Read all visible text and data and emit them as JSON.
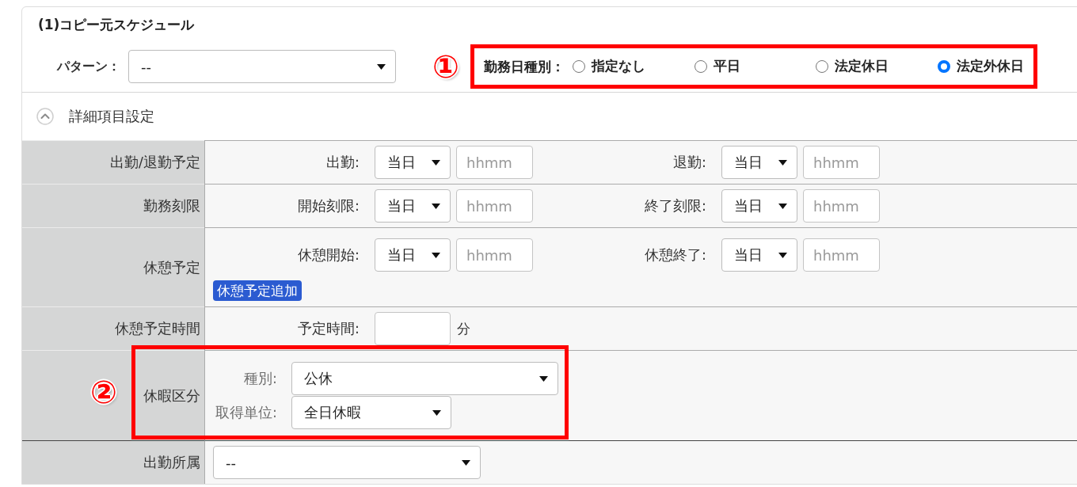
{
  "section": {
    "title": "(1)コピー元スケジュール"
  },
  "pattern": {
    "label": "パターン：",
    "value": "--"
  },
  "workday_type": {
    "annotation": "①",
    "label": "勤務日種別：",
    "options": [
      {
        "label": "指定なし",
        "selected": false
      },
      {
        "label": "平日",
        "selected": false
      },
      {
        "label": "法定休日",
        "selected": false
      },
      {
        "label": "法定外休日",
        "selected": true
      }
    ]
  },
  "details": {
    "label": "詳細項目設定",
    "expanded": true,
    "rows": [
      {
        "kind": "time_pairs",
        "label": "出勤/退勤予定",
        "fields": [
          {
            "label": "出勤:",
            "day": "当日",
            "placeholder": "hhmm"
          },
          {
            "label": "退勤:",
            "day": "当日",
            "placeholder": "hhmm"
          }
        ]
      },
      {
        "kind": "time_pairs",
        "label": "勤務刻限",
        "fields": [
          {
            "label": "開始刻限:",
            "day": "当日",
            "placeholder": "hhmm"
          },
          {
            "label": "終了刻限:",
            "day": "当日",
            "placeholder": "hhmm"
          }
        ]
      },
      {
        "kind": "time_pairs",
        "label": "休憩予定",
        "fields": [
          {
            "label": "休憩開始:",
            "day": "当日",
            "placeholder": "hhmm"
          },
          {
            "label": "休憩終了:",
            "day": "当日",
            "placeholder": "hhmm"
          }
        ],
        "button": "休憩予定追加"
      },
      {
        "kind": "duration",
        "label": "休憩予定時間",
        "field": {
          "label": "予定時間:",
          "unit": "分"
        }
      },
      {
        "kind": "selects",
        "label": "休暇区分",
        "annotation": "②",
        "fields": [
          {
            "label": "種別:",
            "value": "公休"
          },
          {
            "label": "取得単位:",
            "value": "全日休暇"
          }
        ]
      },
      {
        "kind": "select",
        "label": "出勤所属",
        "value": "--"
      }
    ]
  }
}
